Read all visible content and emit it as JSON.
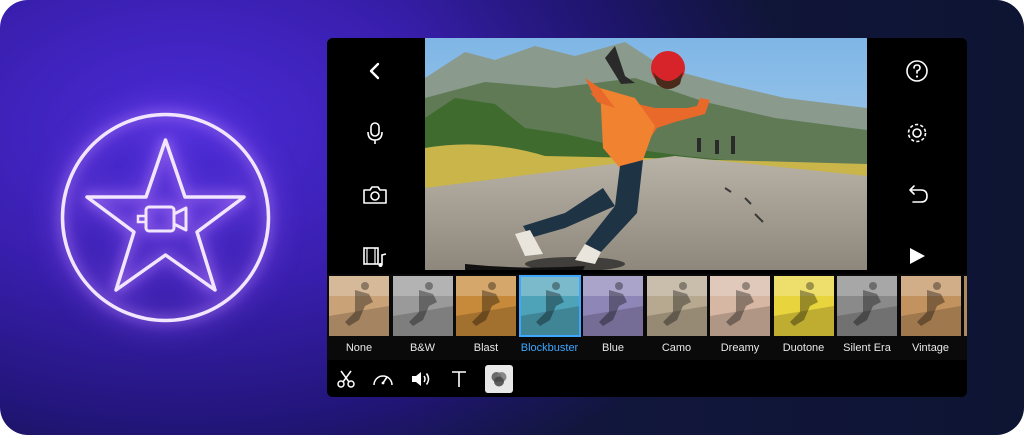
{
  "app": {
    "logo": "imovie-star-camera-icon",
    "accent": "#3ea6ff",
    "glow": "#b37aff"
  },
  "left_rail": {
    "items": [
      {
        "icon": "back-chevron-icon"
      },
      {
        "icon": "microphone-icon"
      },
      {
        "icon": "camera-icon"
      },
      {
        "icon": "media-music-icon"
      }
    ]
  },
  "right_rail": {
    "items": [
      {
        "icon": "help-icon"
      },
      {
        "icon": "settings-gear-icon"
      },
      {
        "icon": "undo-icon"
      },
      {
        "icon": "play-icon"
      }
    ]
  },
  "filters": {
    "selected": "Blockbuster",
    "items": [
      {
        "label": "None",
        "tint": "#c9a277"
      },
      {
        "label": "B&W",
        "tint": "#9a9a9a"
      },
      {
        "label": "Blast",
        "tint": "#c78a3a"
      },
      {
        "label": "Blockbuster",
        "tint": "#4fa3b8"
      },
      {
        "label": "Blue",
        "tint": "#8f86b8"
      },
      {
        "label": "Camo",
        "tint": "#b7a98f"
      },
      {
        "label": "Dreamy",
        "tint": "#d6b7a3"
      },
      {
        "label": "Duotone",
        "tint": "#e8d43c"
      },
      {
        "label": "Silent Era",
        "tint": "#8a8a8a"
      },
      {
        "label": "Vintage",
        "tint": "#c2935f"
      }
    ]
  },
  "toolbar": {
    "items": [
      {
        "icon": "scissors-icon",
        "active": false
      },
      {
        "icon": "speedometer-icon",
        "active": false
      },
      {
        "icon": "volume-icon",
        "active": false
      },
      {
        "icon": "title-text-icon",
        "active": false
      },
      {
        "icon": "filters-icon",
        "active": true
      }
    ]
  }
}
